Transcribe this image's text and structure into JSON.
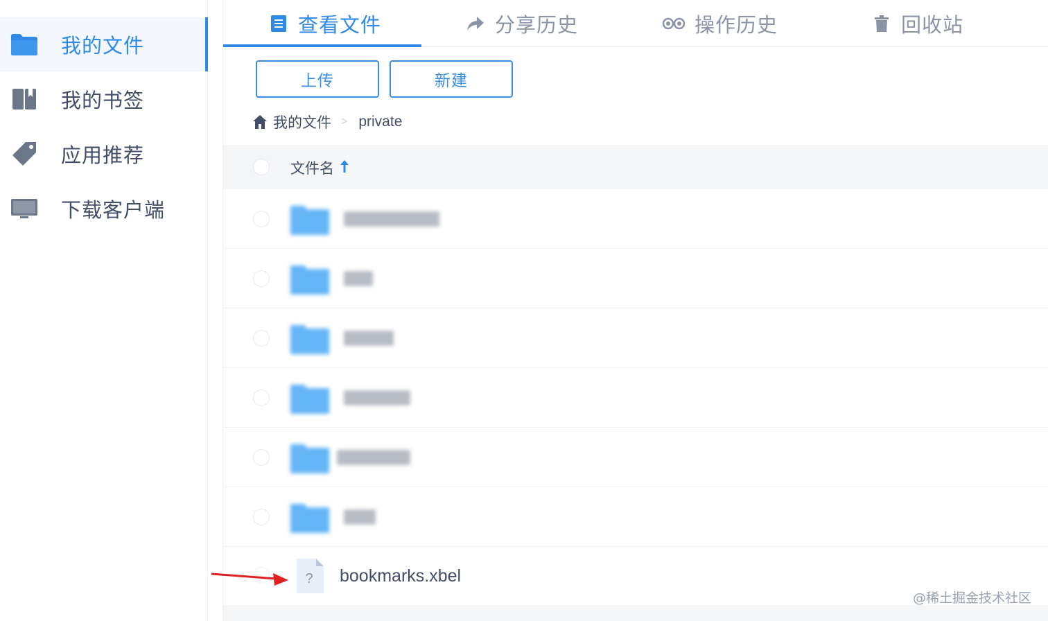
{
  "sidebar": {
    "items": [
      {
        "label": "我的文件",
        "icon": "folder-icon",
        "active": true
      },
      {
        "label": "我的书签",
        "icon": "book-icon",
        "active": false
      },
      {
        "label": "应用推荐",
        "icon": "tag-icon",
        "active": false
      },
      {
        "label": "下载客户端",
        "icon": "monitor-icon",
        "active": false
      }
    ]
  },
  "tabs": [
    {
      "label": "查看文件",
      "icon": "document-icon",
      "active": true
    },
    {
      "label": "分享历史",
      "icon": "share-icon",
      "active": false
    },
    {
      "label": "操作历史",
      "icon": "history-icon",
      "active": false
    },
    {
      "label": "回收站",
      "icon": "trash-icon",
      "active": false
    }
  ],
  "toolbar": {
    "upload_label": "上传",
    "new_label": "新建"
  },
  "breadcrumb": {
    "root": "我的文件",
    "separator": ">",
    "current": "private"
  },
  "table": {
    "column_name": "文件名",
    "sort": "ascending"
  },
  "files": {
    "file_name": "bookmarks.xbel",
    "file_icon_glyph": "?"
  },
  "watermark": "@稀土掘金技术社区",
  "colors": {
    "accent": "#2e8ae6",
    "folder": "#64b5f6",
    "arrow": "#e02020"
  }
}
